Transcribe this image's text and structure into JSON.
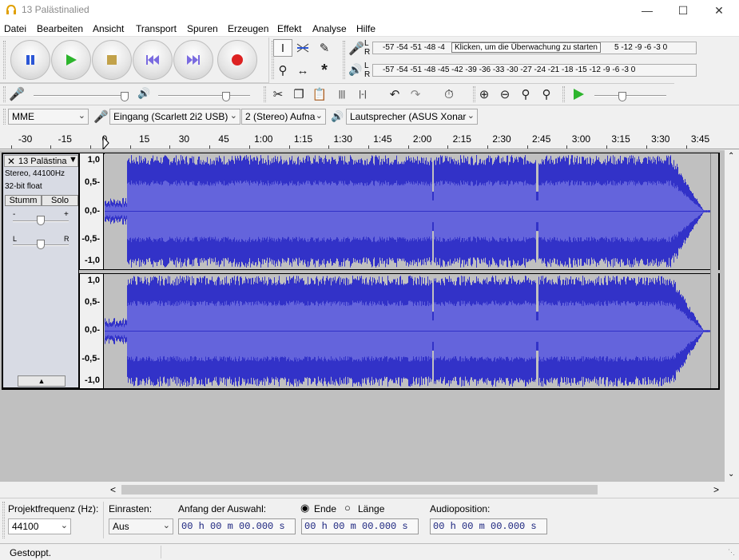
{
  "window": {
    "title": "13 Palästinalied"
  },
  "menu": [
    "Datei",
    "Bearbeiten",
    "Ansicht",
    "Transport",
    "Spuren",
    "Erzeugen",
    "Effekt",
    "Analyse",
    "Hilfe"
  ],
  "meters": {
    "record_scale": "-57 -54 -51 -48 -4",
    "record_scale_right": "5 -12 -9 -6 -3 0",
    "monitor_hint": "Klicken, um die Überwachung zu starten",
    "play_scale": "-57 -54 -51 -48 -45 -42 -39 -36 -33 -30 -27 -24 -21 -18 -15 -12 -9 -6 -3 0",
    "lr_top_l": "L",
    "lr_top_r": "R",
    "lr_bot_l": "L",
    "lr_bot_r": "R"
  },
  "device": {
    "host": "MME",
    "input": "Eingang (Scarlett 2i2 USB)",
    "channels": "2 (Stereo) Aufna",
    "output": "Lautsprecher (ASUS Xonar"
  },
  "ruler": [
    "-30",
    "-15",
    "0",
    "15",
    "30",
    "45",
    "1:00",
    "1:15",
    "1:30",
    "1:45",
    "2:00",
    "2:15",
    "2:30",
    "2:45",
    "3:00",
    "3:15",
    "3:30",
    "3:45"
  ],
  "track": {
    "name": "13 Palästina",
    "info1": "Stereo, 44100Hz",
    "info2": "32-bit float",
    "mute": "Stumm",
    "solo": "Solo",
    "pan_left": "L",
    "pan_right": "R",
    "gain_minus": "-",
    "gain_plus": "+",
    "scale": [
      "1,0",
      "0,5-",
      "0,0-",
      "-0,5-",
      "-1,0"
    ],
    "color_wave": "#3232c8",
    "color_rms": "#6464dc"
  },
  "bottom": {
    "rate_label": "Projektfrequenz (Hz):",
    "rate_value": "44100",
    "snap_label": "Einrasten:",
    "snap_value": "Aus",
    "sel_label": "Anfang der Auswahl:",
    "end_label": "Ende",
    "len_label": "Länge",
    "audio_label": "Audioposition:",
    "time1": "00 h 00 m 00.000 s",
    "time2": "00 h 00 m 00.000 s",
    "time3": "00 h 00 m 00.000 s"
  },
  "status": "Gestoppt."
}
